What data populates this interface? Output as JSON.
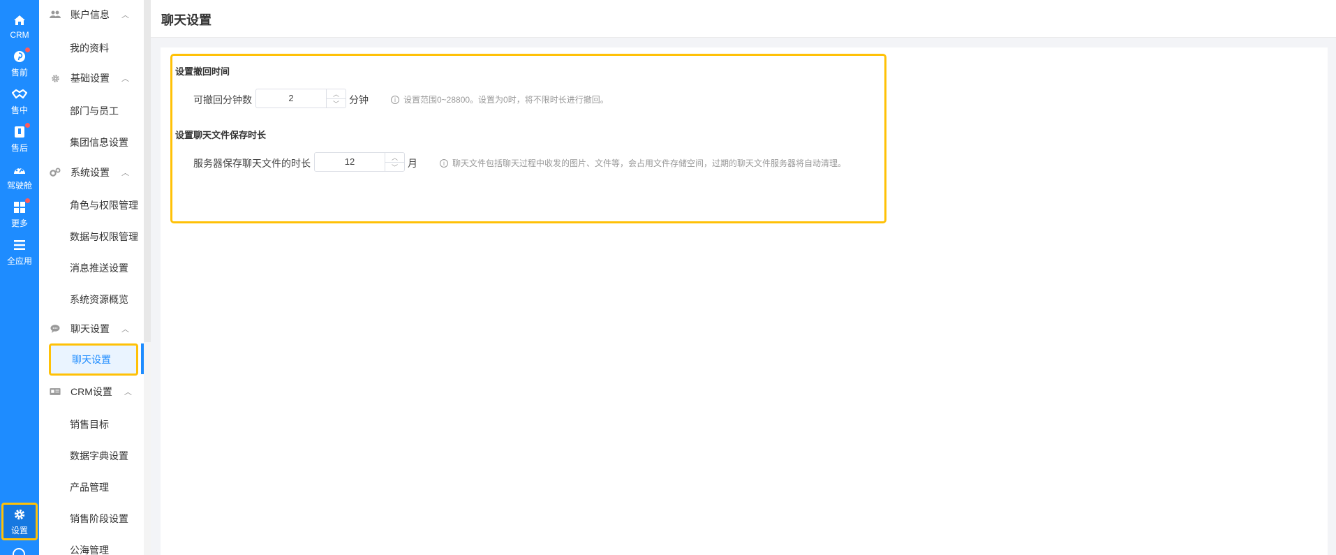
{
  "rail": {
    "items": [
      {
        "label": "CRM",
        "icon": "home-icon"
      },
      {
        "label": "售前",
        "icon": "pinterest-icon"
      },
      {
        "label": "售中",
        "icon": "handshake-icon"
      },
      {
        "label": "售后",
        "icon": "document-icon"
      },
      {
        "label": "驾驶舱",
        "icon": "dashboard-icon"
      },
      {
        "label": "更多",
        "icon": "grid-icon"
      },
      {
        "label": "全应用",
        "icon": "menu-icon"
      },
      {
        "label": "设置",
        "icon": "gear-icon"
      }
    ]
  },
  "submenu": {
    "groups": {
      "account": {
        "label": "账户信息",
        "items": [
          "我的资料"
        ]
      },
      "basic": {
        "label": "基础设置",
        "items": [
          "部门与员工",
          "集团信息设置"
        ]
      },
      "system": {
        "label": "系统设置",
        "items": [
          "角色与权限管理",
          "数据与权限管理",
          "消息推送设置",
          "系统资源概览"
        ]
      },
      "chat": {
        "label": "聊天设置",
        "items": [
          "聊天设置"
        ]
      },
      "crm": {
        "label": "CRM设置",
        "items": [
          "销售目标",
          "数据字典设置",
          "产品管理",
          "销售阶段设置",
          "公海管理"
        ]
      }
    }
  },
  "header": {
    "title": "聊天设置"
  },
  "settings": {
    "recall": {
      "section_title": "设置撤回时间",
      "label": "可撤回分钟数",
      "value": "2",
      "unit": "分钟",
      "hint": "设置范围0~28800。设置为0时，将不限时长进行撤回。"
    },
    "file_retention": {
      "section_title": "设置聊天文件保存时长",
      "label": "服务器保存聊天文件的时长",
      "value": "12",
      "unit": "月",
      "hint": "聊天文件包括聊天过程中收发的图片、文件等，会占用文件存储空间，过期的聊天文件服务器将自动清理。"
    }
  },
  "colors": {
    "accent": "#1e8cff",
    "highlight": "#ffc107",
    "badge": "#ff5b5b"
  }
}
